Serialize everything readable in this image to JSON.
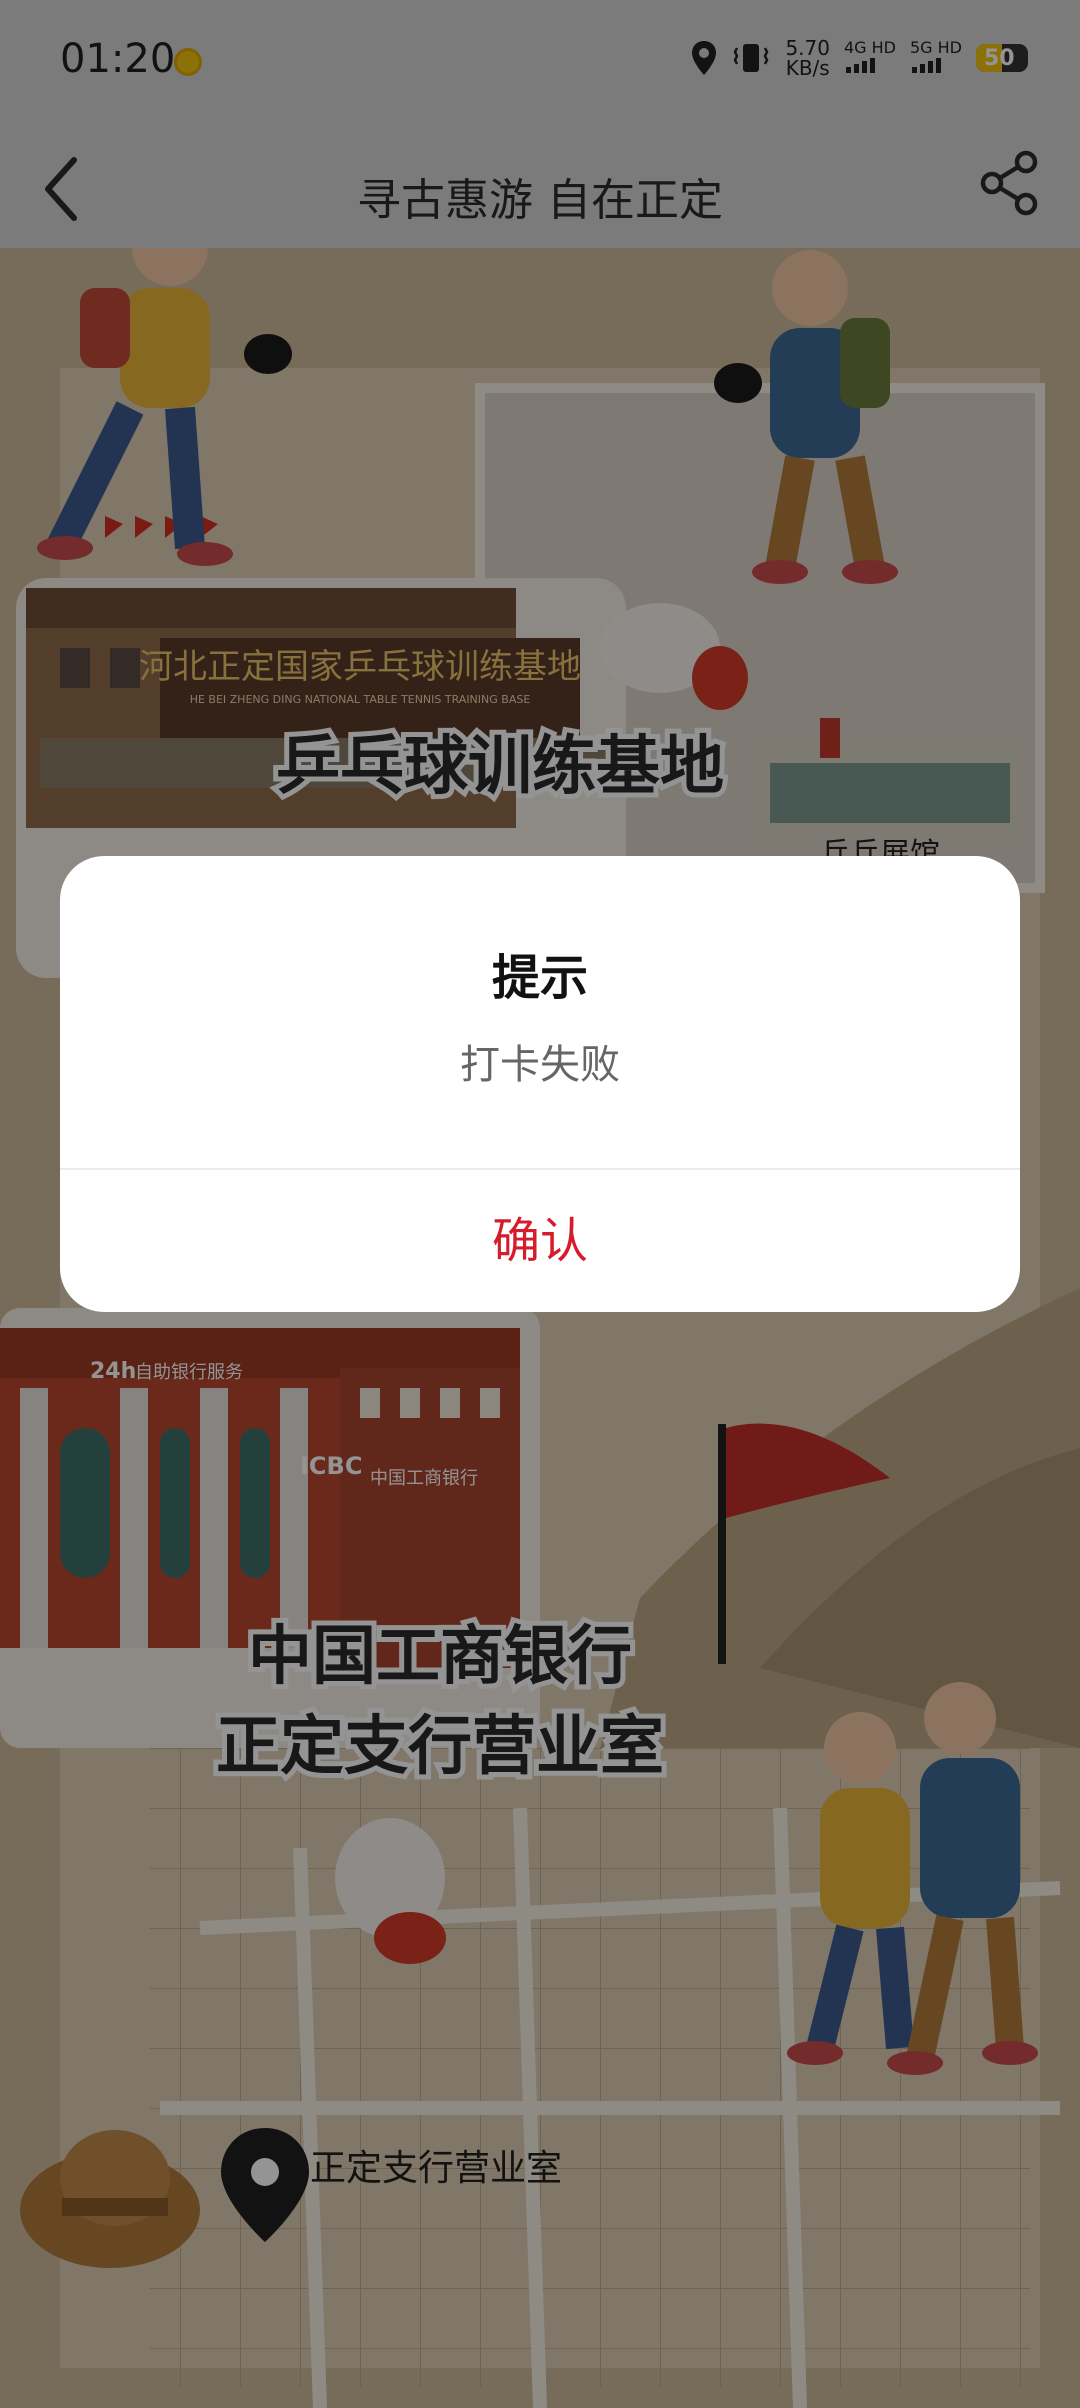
{
  "status_bar": {
    "time": "01:20",
    "net_speed_value": "5.70",
    "net_speed_unit": "KB/s",
    "sim1_label": "4G HD",
    "sim2_label": "5G HD",
    "battery": "50",
    "battery_level": 0.5,
    "icons": [
      "coin-icon",
      "location-icon",
      "vibrate-icon",
      "signal-icon",
      "battery-icon"
    ]
  },
  "navbar": {
    "title": "寻古惠游 自在正定",
    "back_icon": "chevron-left-icon",
    "share_icon": "share-icon"
  },
  "poster": {
    "sign_text": "河北正定国家乒乓球训练基地",
    "sign_text_pinyin": "HE BEI ZHENG DING NATIONAL TABLE TENNIS TRAINING BASE",
    "spot1_title": "乒乓球训练基地",
    "spot1_sub": "乒乓展馆",
    "bank_sign_24h": "24h",
    "bank_sign_self": "自助银行服务",
    "bank_icbc": "ICBC",
    "bank_icbc_cn": "中国工商银行",
    "spot2_title_line1": "中国工商银行",
    "spot2_title_line2": "正定支行营业室",
    "location_label": "正定支行营业室"
  },
  "dialog": {
    "title": "提示",
    "message": "打卡失败",
    "confirm_label": "确认"
  },
  "colors": {
    "accent": "#d61c2b",
    "poster_bg": "#cdb999",
    "bar_bg": "#d4d4d4"
  }
}
